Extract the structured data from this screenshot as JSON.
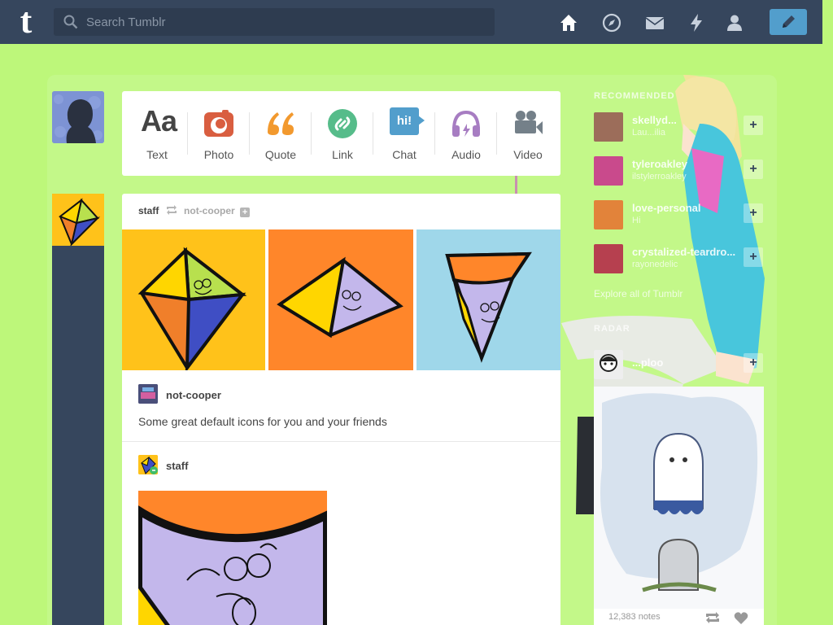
{
  "header": {
    "logo": "t",
    "search_placeholder": "Search Tumblr",
    "nav": [
      "home-icon",
      "explore-compass-icon",
      "inbox-envelope-icon",
      "activity-lightning-icon",
      "account-person-icon"
    ],
    "compose_icon": "pencil-icon"
  },
  "post_types": [
    {
      "label": "Text",
      "glyph": "Aa",
      "color": "#444444"
    },
    {
      "label": "Photo",
      "color": "#d95e40"
    },
    {
      "label": "Quote",
      "color": "#f2992e"
    },
    {
      "label": "Link",
      "color": "#56bc8a"
    },
    {
      "label": "Chat",
      "glyph": "hi!",
      "color": "#529ecc"
    },
    {
      "label": "Audio",
      "color": "#a77dc2"
    },
    {
      "label": "Video",
      "color": "#748089"
    }
  ],
  "post": {
    "author": "staff",
    "reblogged_from": "not-cooper",
    "trail": [
      {
        "name": "not-cooper",
        "text": "Some great default icons for you and your friends"
      },
      {
        "name": "staff"
      }
    ]
  },
  "sidebar": {
    "title": "RECOMMENDED",
    "recommendations": [
      {
        "name": "skellyd...",
        "sub": "Lau...ilia",
        "color": "#9c6d5a"
      },
      {
        "name": "tyleroakley",
        "sub": "ilstylerroakley",
        "color": "#c94a8c"
      },
      {
        "name": "love-personal",
        "sub": "Hi",
        "color": "#e2833a"
      },
      {
        "name": "crystalized-teardro...",
        "sub": "rayonedelic",
        "color": "#b6404f"
      }
    ],
    "explore": "Explore all of Tumblr",
    "radar_title": "RADAR",
    "radar_user": "...ploo",
    "radar_notes": "12,383 notes"
  },
  "colors": {
    "background": "#bdf77a",
    "header": "#36465d",
    "accent": "#529ecc"
  }
}
